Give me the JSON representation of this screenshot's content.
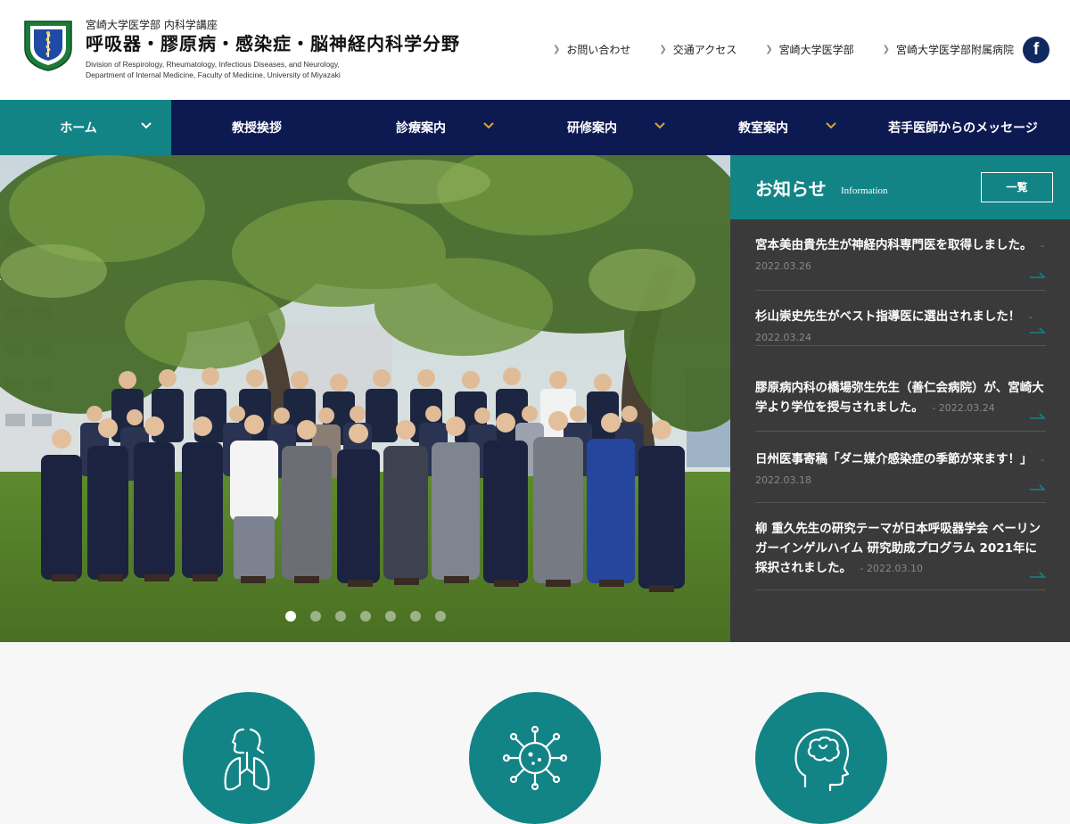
{
  "header": {
    "subtitle": "宮崎大学医学部 内科学講座",
    "title": "呼吸器・膠原病・感染症・脳神経内科学分野",
    "english_line1": "Division of Respirology, Rheumatology, Infectious Diseases, and Neurology,",
    "english_line2": "Department of Internal Medicine, Faculty of Medicine, University of Miyazaki",
    "links": [
      {
        "label": "お問い合わせ"
      },
      {
        "label": "交通アクセス"
      },
      {
        "label": "宮崎大学医学部"
      },
      {
        "label": "宮崎大学医学部附属病院"
      }
    ],
    "facebook_icon": "facebook-icon",
    "facebook_glyph": "f"
  },
  "nav": {
    "items": [
      {
        "label": "ホーム",
        "active": true,
        "dropdown": true
      },
      {
        "label": "教授挨拶",
        "active": false,
        "dropdown": false
      },
      {
        "label": "診療案内",
        "active": false,
        "dropdown": true
      },
      {
        "label": "研修案内",
        "active": false,
        "dropdown": true
      },
      {
        "label": "教室案内",
        "active": false,
        "dropdown": true
      },
      {
        "label": "若手医師からのメッセージ",
        "active": false,
        "dropdown": false
      }
    ]
  },
  "slider": {
    "slide_count": 7,
    "active_index": 0
  },
  "news": {
    "title": "お知らせ",
    "title_en": "Information",
    "list_button": "一覧",
    "items": [
      {
        "text": "宮本美由貴先生が神経内科専門医を取得しました。",
        "date": "2022.03.26"
      },
      {
        "text": "杉山崇史先生がベスト指導医に選出されました！",
        "date": "2022.03.24"
      },
      {
        "text": "膠原病内科の橋場弥生先生（善仁会病院）が、宮崎大学より学位を授与されました。",
        "date": "2022.03.24"
      },
      {
        "text": "日州医事寄稿「ダニ媒介感染症の季節が来ます！」",
        "date": "2022.03.18"
      },
      {
        "text": "柳 重久先生の研究テーマが日本呼吸器学会 ベーリンガーインゲルハイム 研究助成プログラム 2021年に採択されました。",
        "date": "2022.03.10"
      }
    ]
  },
  "features": [
    {
      "icon": "lungs-icon"
    },
    {
      "icon": "virus-icon"
    },
    {
      "icon": "brain-head-icon"
    }
  ],
  "colors": {
    "teal": "#128486",
    "navy": "#0d1a52",
    "news_bg": "#3a3a3a"
  }
}
